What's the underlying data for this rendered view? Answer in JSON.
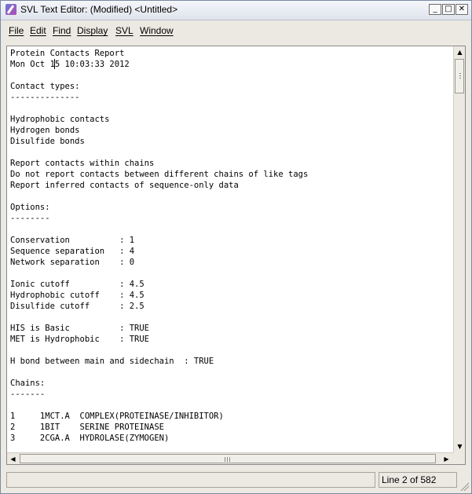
{
  "window": {
    "title": "SVL Text Editor: (Modified) <Untitled>",
    "app_icon": "svl-editor-icon",
    "buttons": {
      "minimize": "_",
      "maximize": "□",
      "close": "✕"
    }
  },
  "menu": {
    "items": [
      {
        "label": "File"
      },
      {
        "label": "Edit"
      },
      {
        "label": "Find"
      },
      {
        "label": "Display"
      },
      {
        "label": "SVL"
      },
      {
        "label": "Window"
      }
    ]
  },
  "editor": {
    "lines": [
      "Protein Contacts Report",
      "Mon Oct 15 10:03:33 2012",
      "",
      "Contact types:",
      "--------------",
      "",
      "Hydrophobic contacts",
      "Hydrogen bonds",
      "Disulfide bonds",
      "",
      "Report contacts within chains",
      "Do not report contacts between different chains of like tags",
      "Report inferred contacts of sequence-only data",
      "",
      "Options:",
      "--------",
      "",
      "Conservation          : 1",
      "Sequence separation   : 4",
      "Network separation    : 0",
      "",
      "Ionic cutoff          : 4.5",
      "Hydrophobic cutoff    : 4.5",
      "Disulfide cutoff      : 2.5",
      "",
      "HIS is Basic          : TRUE",
      "MET is Hydrophobic    : TRUE",
      "",
      "H bond between main and sidechain  : TRUE",
      "",
      "Chains:",
      "-------",
      "",
      "1     1MCT.A  COMPLEX(PROTEINASE/INHIBITOR)",
      "2     1BIT    SERINE PROTEINASE",
      "3     2CGA.A  HYDROLASE(ZYMOGEN)"
    ]
  },
  "scrollbars": {
    "up_arrow": "▲",
    "down_arrow": "▼",
    "left_arrow": "◀",
    "right_arrow": "▶"
  },
  "status": {
    "message": "",
    "position": "Line 2 of 582"
  }
}
